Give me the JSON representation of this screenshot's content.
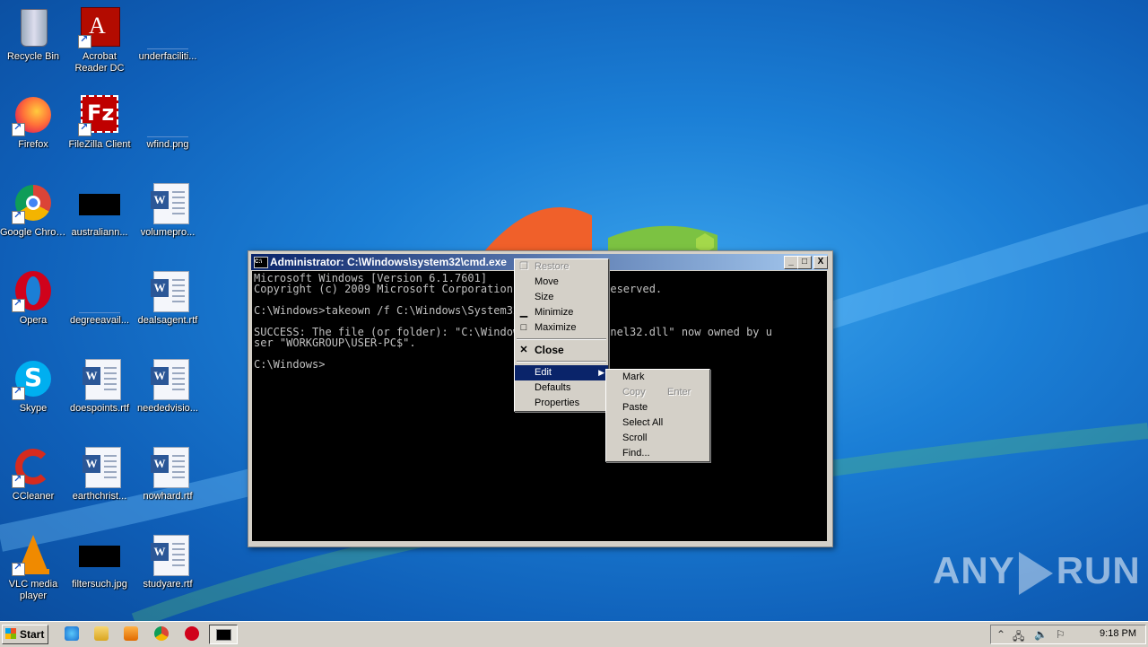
{
  "desktop": {
    "icons": [
      {
        "label": "Recycle Bin",
        "icon": "recycle-bin-icon"
      },
      {
        "label": "Acrobat Reader DC",
        "icon": "acrobat-icon"
      },
      {
        "label": "underfaciliti...",
        "icon": "file-icon"
      },
      {
        "label": "Firefox",
        "icon": "firefox-icon"
      },
      {
        "label": "FileZilla Client",
        "icon": "filezilla-icon"
      },
      {
        "label": "wfind.png",
        "icon": "image-file-icon"
      },
      {
        "label": "Google Chrome",
        "icon": "chrome-icon"
      },
      {
        "label": "australiann...",
        "icon": "image-file-icon"
      },
      {
        "label": "volumepro...",
        "icon": "word-doc-icon"
      },
      {
        "label": "Opera",
        "icon": "opera-icon"
      },
      {
        "label": "degreeavail...",
        "icon": "file-icon"
      },
      {
        "label": "dealsagent.rtf",
        "icon": "word-doc-icon"
      },
      {
        "label": "Skype",
        "icon": "skype-icon"
      },
      {
        "label": "doespoints.rtf",
        "icon": "word-doc-icon"
      },
      {
        "label": "neededvisio...",
        "icon": "word-doc-icon"
      },
      {
        "label": "CCleaner",
        "icon": "ccleaner-icon"
      },
      {
        "label": "earthchrist...",
        "icon": "word-doc-icon"
      },
      {
        "label": "nowhard.rtf",
        "icon": "word-doc-icon"
      },
      {
        "label": "VLC media player",
        "icon": "vlc-icon"
      },
      {
        "label": "filtersuch.jpg",
        "icon": "image-file-icon"
      },
      {
        "label": "studyare.rtf",
        "icon": "word-doc-icon"
      }
    ]
  },
  "cmd": {
    "title": "Administrator: C:\\Windows\\system32\\cmd.exe",
    "title_icon": "C:\\",
    "buttons": {
      "minimize": "_",
      "maximize": "□",
      "close": "X"
    },
    "lines": [
      "Microsoft Windows [Version 6.1.7601]",
      "Copyright (c) 2009 Microsoft Corporation.  All rights reserved.",
      "",
      "C:\\Windows>takeown /f C:\\Windows\\System32\\kernel32.dll",
      "",
      "SUCCESS: The file (or folder): \"C:\\Windows\\System32\\kernel32.dll\" now owned by u",
      "ser \"WORKGROUP\\USER-PC$\".",
      "",
      "C:\\Windows>"
    ]
  },
  "system_menu": {
    "items": [
      {
        "label": "Restore",
        "disabled": true,
        "icon": "restore-icon"
      },
      {
        "label": "Move"
      },
      {
        "label": "Size"
      },
      {
        "label": "Minimize",
        "icon": "minimize-icon"
      },
      {
        "label": "Maximize",
        "icon": "maximize-icon"
      },
      {
        "label": "Close",
        "icon": "close-icon",
        "bold": true
      },
      {
        "label": "Edit",
        "highlighted": true,
        "submenu": true
      },
      {
        "label": "Defaults"
      },
      {
        "label": "Properties"
      }
    ]
  },
  "edit_submenu": {
    "items": [
      {
        "label": "Mark"
      },
      {
        "label": "Copy",
        "shortcut": "Enter",
        "disabled": true
      },
      {
        "label": "Paste"
      },
      {
        "label": "Select All"
      },
      {
        "label": "Scroll"
      },
      {
        "label": "Find..."
      }
    ]
  },
  "taskbar": {
    "start_label": "Start",
    "quicklaunch": [
      "ie-icon",
      "explorer-icon",
      "media-player-icon",
      "chrome-icon",
      "opera-icon"
    ],
    "active_task": "cmd-icon",
    "clock": "9:18 PM"
  },
  "watermark": {
    "left": "ANY",
    "right": "RUN"
  }
}
